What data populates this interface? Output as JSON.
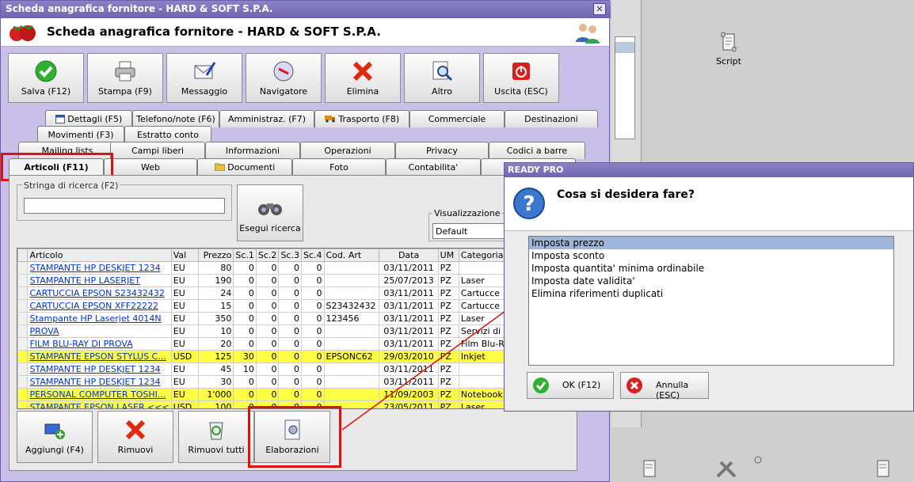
{
  "window": {
    "titlebar": "Scheda anagrafica fornitore - HARD & SOFT S.P.A.",
    "heading": "Scheda anagrafica fornitore - HARD & SOFT S.P.A.",
    "close_label": "✕"
  },
  "desktop": {
    "script_label": "Script"
  },
  "toolbar": [
    {
      "label": "Salva (F12)",
      "icon": "check-icon"
    },
    {
      "label": "Stampa (F9)",
      "icon": "printer-icon"
    },
    {
      "label": "Messaggio",
      "icon": "envelope-icon"
    },
    {
      "label": "Navigatore",
      "icon": "compass-icon"
    },
    {
      "label": "Elimina",
      "icon": "red-x-icon"
    },
    {
      "label": "Altro",
      "icon": "search-doc-icon"
    },
    {
      "label": "Uscita (ESC)",
      "icon": "exit-icon"
    }
  ],
  "tabs": {
    "row1": [
      "Dettagli (F5)",
      "Telefono/note (F6)",
      "Amministraz. (F7)",
      "Trasporto (F8)",
      "Commerciale",
      "Destinazioni"
    ],
    "row2": [
      "Movimenti (F3)",
      "Estratto conto (F10)"
    ],
    "row3": [
      "Mailing lists",
      "Campi liberi",
      "Informazioni",
      "Operazioni",
      "Privacy",
      "Codici a barre"
    ],
    "row4": [
      "Articoli (F11)",
      "Web",
      "Documenti",
      "Foto",
      "Contabilita'",
      ""
    ]
  },
  "search": {
    "label": "Stringa di ricerca (F2)",
    "value": "",
    "button": "Esegui ricerca"
  },
  "visualizzazione": {
    "label": "Visualizzazione",
    "value": "Default"
  },
  "grid": {
    "columns": [
      "Articolo",
      "Val",
      "Prezzo",
      "Sc.1",
      "Sc.2",
      "Sc.3",
      "Sc.4",
      "Cod. Art",
      "Data",
      "UM",
      "Categoria"
    ],
    "rows": [
      {
        "articolo": "STAMPANTE HP DESKJET 1234",
        "val": "EU",
        "prezzo": "80",
        "sc1": "0",
        "sc2": "0",
        "sc3": "0",
        "sc4": "0",
        "cod": "",
        "data": "03/11/2011",
        "um": "PZ",
        "cat": "",
        "hl": false
      },
      {
        "articolo": "STAMPANTE HP LASERJET",
        "val": "EU",
        "prezzo": "190",
        "sc1": "0",
        "sc2": "0",
        "sc3": "0",
        "sc4": "0",
        "cod": "",
        "data": "25/07/2013",
        "um": "PZ",
        "cat": "Laser",
        "hl": false
      },
      {
        "articolo": "CARTUCCIA EPSON S23432432",
        "val": "EU",
        "prezzo": "24",
        "sc1": "0",
        "sc2": "0",
        "sc3": "0",
        "sc4": "0",
        "cod": "",
        "data": "03/11/2011",
        "um": "PZ",
        "cat": "Cartucce",
        "hl": false
      },
      {
        "articolo": "CARTUCCIA EPSON XFF22222",
        "val": "EU",
        "prezzo": "15",
        "sc1": "0",
        "sc2": "0",
        "sc3": "0",
        "sc4": "0",
        "cod": "S23432432",
        "data": "03/11/2011",
        "um": "PZ",
        "cat": "Cartucce",
        "hl": false
      },
      {
        "articolo": "Stampante HP Laserjet 4014N",
        "val": "EU",
        "prezzo": "350",
        "sc1": "0",
        "sc2": "0",
        "sc3": "0",
        "sc4": "0",
        "cod": "123456",
        "data": "03/11/2011",
        "um": "PZ",
        "cat": "Laser",
        "hl": false
      },
      {
        "articolo": "PROVA",
        "val": "EU",
        "prezzo": "10",
        "sc1": "0",
        "sc2": "0",
        "sc3": "0",
        "sc4": "0",
        "cod": "",
        "data": "03/11/2011",
        "um": "PZ",
        "cat": "Servizi di",
        "hl": false
      },
      {
        "articolo": "FILM BLU-RAY DI PROVA",
        "val": "EU",
        "prezzo": "20",
        "sc1": "0",
        "sc2": "0",
        "sc3": "0",
        "sc4": "0",
        "cod": "",
        "data": "03/11/2011",
        "um": "PZ",
        "cat": "Film Blu-R",
        "hl": false
      },
      {
        "articolo": "STAMPANTE EPSON STYLUS C...",
        "val": "USD",
        "prezzo": "125",
        "sc1": "30",
        "sc2": "0",
        "sc3": "0",
        "sc4": "0",
        "cod": "EPSONC62",
        "data": "29/03/2010",
        "um": "PZ",
        "cat": "Inkjet",
        "hl": true
      },
      {
        "articolo": "STAMPANTE HP DESKJET 1234",
        "val": "EU",
        "prezzo": "45",
        "sc1": "10",
        "sc2": "0",
        "sc3": "0",
        "sc4": "0",
        "cod": "",
        "data": "03/11/2011",
        "um": "PZ",
        "cat": "",
        "hl": false
      },
      {
        "articolo": "STAMPANTE HP DESKJET 1234",
        "val": "EU",
        "prezzo": "30",
        "sc1": "0",
        "sc2": "0",
        "sc3": "0",
        "sc4": "0",
        "cod": "",
        "data": "03/11/2011",
        "um": "PZ",
        "cat": "",
        "hl": false
      },
      {
        "articolo": "PERSONAL COMPUTER TOSHI...",
        "val": "EU",
        "prezzo": "1'000",
        "sc1": "0",
        "sc2": "0",
        "sc3": "0",
        "sc4": "0",
        "cod": "",
        "data": "11/09/2003",
        "um": "PZ",
        "cat": "Notebook",
        "hl": true
      },
      {
        "articolo": "STAMPANTE EPSON LASER <<<",
        "val": "USD",
        "prezzo": "100",
        "sc1": "0",
        "sc2": "0",
        "sc3": "0",
        "sc4": "0",
        "cod": "",
        "data": "23/05/2011",
        "um": "PZ",
        "cat": "Laser",
        "hl": true
      }
    ]
  },
  "bottombar": [
    {
      "label": "Aggiungi (F4)",
      "icon": "add-icon"
    },
    {
      "label": "Rimuovi",
      "icon": "red-x-icon"
    },
    {
      "label": "Rimuovi tutti",
      "icon": "recycle-bin-icon"
    },
    {
      "label": "Elaborazioni",
      "icon": "processing-doc-icon"
    }
  ],
  "dialog": {
    "title": "READY PRO",
    "question": "Cosa si desidera fare?",
    "options": [
      "Imposta prezzo",
      "Imposta sconto",
      "Imposta quantita' minima ordinabile",
      "Imposta date validita'",
      "Elimina riferimenti duplicati"
    ],
    "selected_index": 0,
    "ok": "OK (F12)",
    "cancel": "Annulla (ESC)"
  },
  "colors": {
    "title": "#6f64b0",
    "highlight_row": "#ffff44",
    "link": "#0033cc",
    "annotation": "#e01010",
    "selection": "#9cb5d8"
  }
}
